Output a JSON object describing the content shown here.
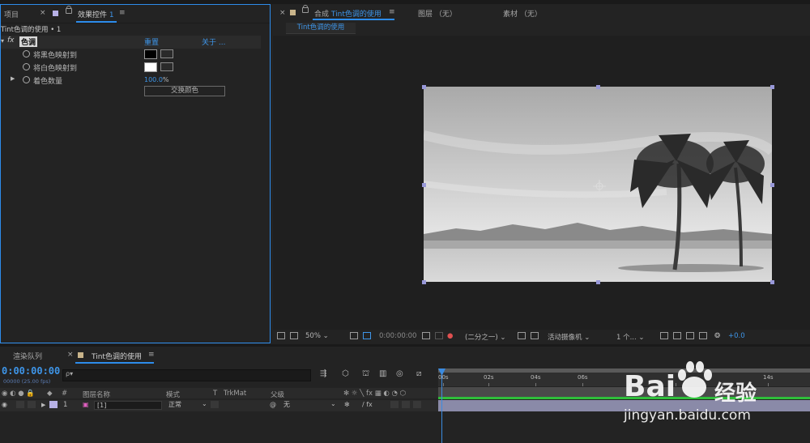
{
  "project_panel": {
    "tab_project": "项目",
    "tab_effect_controls": "效果控件",
    "effect_controls_index": "1",
    "comp_ref": "Tint色调的使用 • 1",
    "effect": {
      "fx": "fx",
      "name": "色调",
      "reset": "重置",
      "about": "关于 ...",
      "map_black_label": "将黑色映射到",
      "map_white_label": "将白色映射到",
      "amount_label": "着色数量",
      "amount_value": "100.0",
      "amount_unit": "%",
      "swap_button": "交换颜色"
    }
  },
  "composition_panel": {
    "close": "×",
    "tab_label": "合成",
    "comp_name": "Tint色调的使用",
    "menu": "≡",
    "layer_tab": "图层 （无）",
    "footage_tab": "素材 （无）",
    "breadcrumb": "Tint色调的使用"
  },
  "viewer_toolbar": {
    "zoom": "50%",
    "timecode": "0:00:00:00",
    "resolution": "(二分之一)",
    "camera": "活动摄像机",
    "views": "1 个...",
    "exposure": "+0.0"
  },
  "bottom_tabs": {
    "render_queue": "渲染队列",
    "close": "×",
    "timeline_tab": "Tint色调的使用",
    "menu": "≡"
  },
  "timeline": {
    "timecode": "0:00:00:00",
    "fps": "00000 (25.00 fps)",
    "search_placeholder": "ρ▾",
    "columns": {
      "hash": "#",
      "layer_name": "图层名称",
      "mode": "模式",
      "t": "T",
      "trkmat": "TrkMat",
      "parent": "父级"
    },
    "ruler_ticks": [
      "00s",
      "02s",
      "04s",
      "06s",
      "14s"
    ],
    "layer": {
      "index": "1",
      "name": "[1]",
      "mode": "正常",
      "parent": "无",
      "switch_fx": "/ fx"
    }
  },
  "watermark": {
    "brand": "Bai",
    "brand2": "经验",
    "url": "jingyan.baidu.com"
  },
  "colors": {
    "accent": "#2d8ceb",
    "panel_bg": "#232323",
    "layer_bar": "#8a8aa8",
    "green_line": "#2fbf3a"
  }
}
